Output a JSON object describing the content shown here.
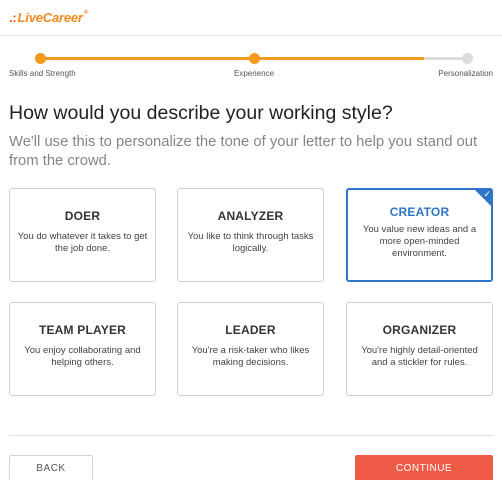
{
  "header": {
    "logo_dots": ".:",
    "logo_text": "LiveCareer",
    "logo_mark": "®"
  },
  "progress": {
    "fraction": 0.9,
    "steps": [
      {
        "label": "Skills and Strength",
        "state": "done"
      },
      {
        "label": "Experience",
        "state": "done"
      },
      {
        "label": "Personalization",
        "state": "todo"
      }
    ]
  },
  "question": {
    "title": "How would you describe your working style?",
    "subtitle": "We'll use this to personalize the tone of your letter to help you stand out from the crowd."
  },
  "options": [
    {
      "title": "DOER",
      "description": "You do whatever it takes to get the job done.",
      "selected": false
    },
    {
      "title": "ANALYZER",
      "description": "You like to think through tasks logically.",
      "selected": false
    },
    {
      "title": "CREATOR",
      "description": "You value new ideas and a more open-minded environment.",
      "selected": true
    },
    {
      "title": "TEAM PLAYER",
      "description": "You enjoy collaborating and helping others.",
      "selected": false
    },
    {
      "title": "LEADER",
      "description": "You're a risk-taker who likes making decisions.",
      "selected": false
    },
    {
      "title": "ORGANIZER",
      "description": "You're highly detail-oriented and a stickler for rules.",
      "selected": false
    }
  ],
  "footer": {
    "back_label": "BACK",
    "continue_label": "CONTINUE"
  },
  "colors": {
    "accent": "#f29a1d",
    "selected": "#2f76c9",
    "primary_button": "#ee5a45"
  }
}
